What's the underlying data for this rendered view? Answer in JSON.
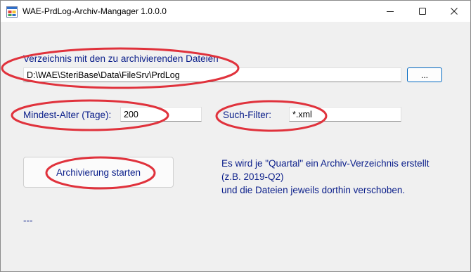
{
  "window": {
    "title": "WAE-PrdLog-Archiv-Mangager 1.0.0.0",
    "icon": "app-window-icon"
  },
  "folder": {
    "label": "Verzeichnis mit den zu archivierenden Dateien",
    "value": "D:\\WAE\\SteriBase\\Data\\FileSrv\\PrdLog",
    "browse_label": "..."
  },
  "age": {
    "label": "Mindest-Alter (Tage):",
    "value": "200"
  },
  "filter": {
    "label": "Such-Filter:",
    "value": "*.xml"
  },
  "start_button": {
    "label": "Archivierung starten"
  },
  "info": {
    "lines": [
      "Es wird je \"Quartal\" ein Archiv-Verzeichnis erstellt",
      "(z.B. 2019-Q2)",
      "und die Dateien jeweils dorthin verschoben."
    ]
  },
  "status": {
    "text": "---"
  },
  "colors": {
    "label_text": "#0a1e8a",
    "annotation_oval": "#e0323c",
    "accent_border": "#0067c0"
  }
}
